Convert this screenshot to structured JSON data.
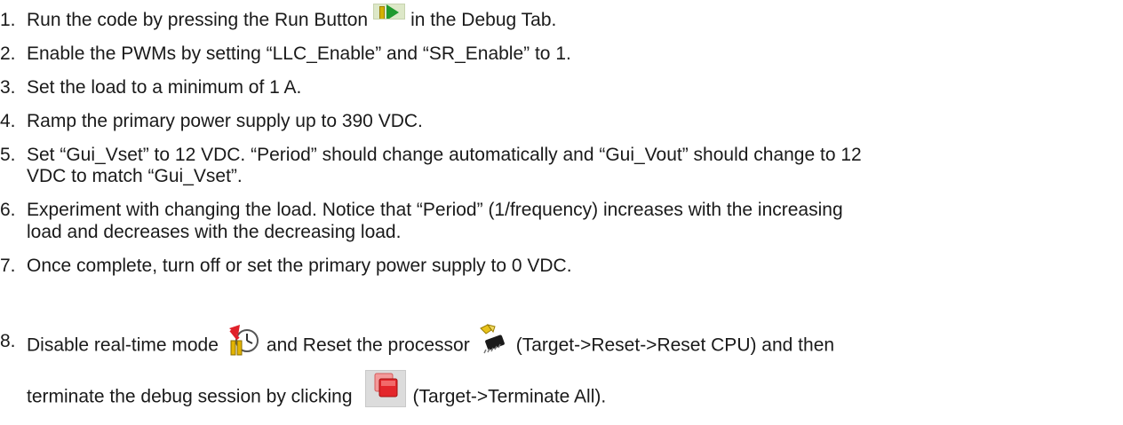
{
  "steps": [
    {
      "number": "1.",
      "text_before": "Run the code by pressing the Run Button",
      "text_after": "in the Debug Tab.",
      "icon": "run-button-icon"
    },
    {
      "number": "2.",
      "text": "Enable the PWMs by setting “LLC_Enable” and “SR_Enable” to 1."
    },
    {
      "number": "3.",
      "text": "Set the load to a minimum of 1 A."
    },
    {
      "number": "4.",
      "text": "Ramp the primary power supply up to 390 VDC."
    },
    {
      "number": "5.",
      "line1": "Set “Gui_Vset” to 12 VDC. “Period” should change automatically and “Gui_Vout” should change to 12",
      "line2": "VDC to match “Gui_Vset”."
    },
    {
      "number": "6.",
      "line1": "Experiment with changing the load. Notice that “Period” (1/frequency) increases with the increasing",
      "line2": "load and decreases with the decreasing load."
    },
    {
      "number": "7.",
      "text": "Once complete, turn off or set the primary power supply to 0 VDC."
    },
    {
      "number": "8.",
      "part1": "Disable real-time mode",
      "part2": "and Reset the processor",
      "part3": "(Target->Reset->Reset CPU) and then",
      "part4": "terminate the debug session by clicking",
      "part5": "(Target->Terminate All).",
      "icons": [
        "realtime-mode-icon",
        "reset-cpu-icon",
        "terminate-icon"
      ]
    }
  ]
}
